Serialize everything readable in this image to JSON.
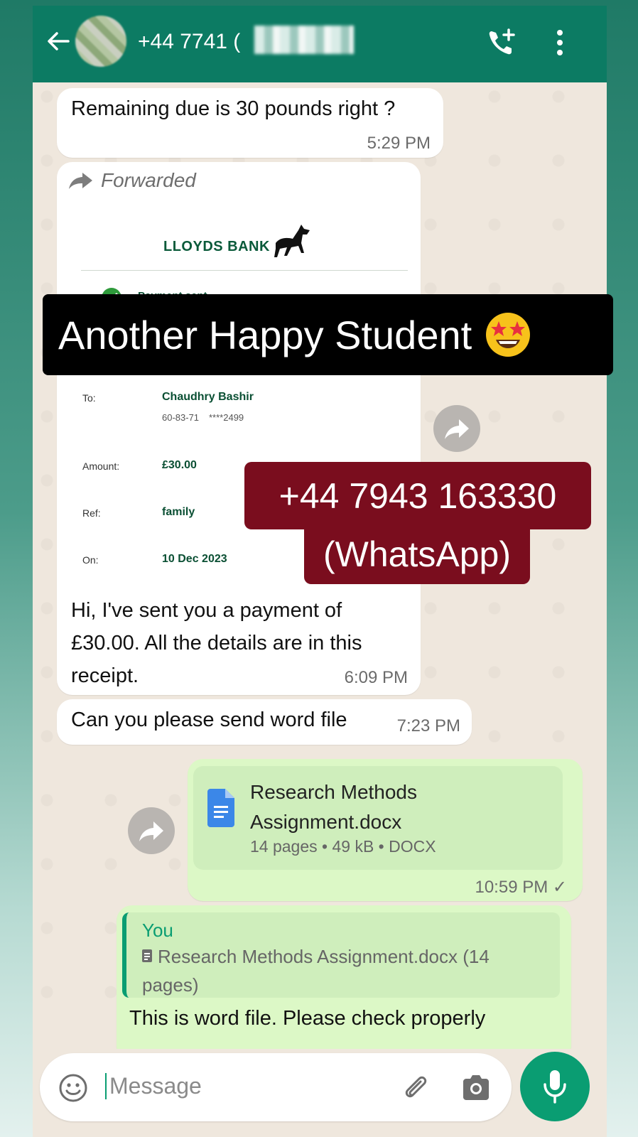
{
  "header": {
    "contact_name": "+44 7741 (",
    "colors": {
      "header_bg": "#0c7b63",
      "accent": "#0a9d72"
    }
  },
  "messages": {
    "m1": {
      "text": "Remaining due is 30 pounds right ?",
      "time": "5:29 PM"
    },
    "m2": {
      "forwarded_label": "Forwarded",
      "receipt": {
        "bank_name": "LLOYDS BANK",
        "status": "Payment sent",
        "to_label": "To:",
        "to_name": "Chaudhry Bashir",
        "sort_code": "60-83-71",
        "account": "****2499",
        "amount_label": "Amount:",
        "amount": "£30.00",
        "ref_label": "Ref:",
        "ref": "family",
        "on_label": "On:",
        "date": "10 Dec 2023"
      },
      "text": "Hi, I've sent you a payment of £30.00. All the details are in this receipt.",
      "time": "6:09 PM"
    },
    "m3": {
      "text": "Can you please send word file",
      "time": "7:23 PM"
    },
    "m4": {
      "doc_name": "Research Methods Assignment.docx",
      "doc_meta": "14 pages • 49 kB • DOCX",
      "time": "10:59 PM ✓"
    },
    "m5": {
      "quote_author": "You",
      "quote_text": "Research Methods Assignment.docx (14 pages)",
      "text": "This is word file. Please check properly"
    }
  },
  "overlays": {
    "banner": "Another Happy Student",
    "phone_line1": "+44 7943 163330",
    "phone_line2": "(WhatsApp)"
  },
  "composer": {
    "placeholder": "Message"
  },
  "icons": [
    "back-arrow-icon",
    "call-add-icon",
    "more-vert-icon",
    "forward-icon",
    "share-icon",
    "document-icon",
    "emoji-icon",
    "attach-icon",
    "camera-icon",
    "mic-icon",
    "star-struck-emoji-icon"
  ]
}
